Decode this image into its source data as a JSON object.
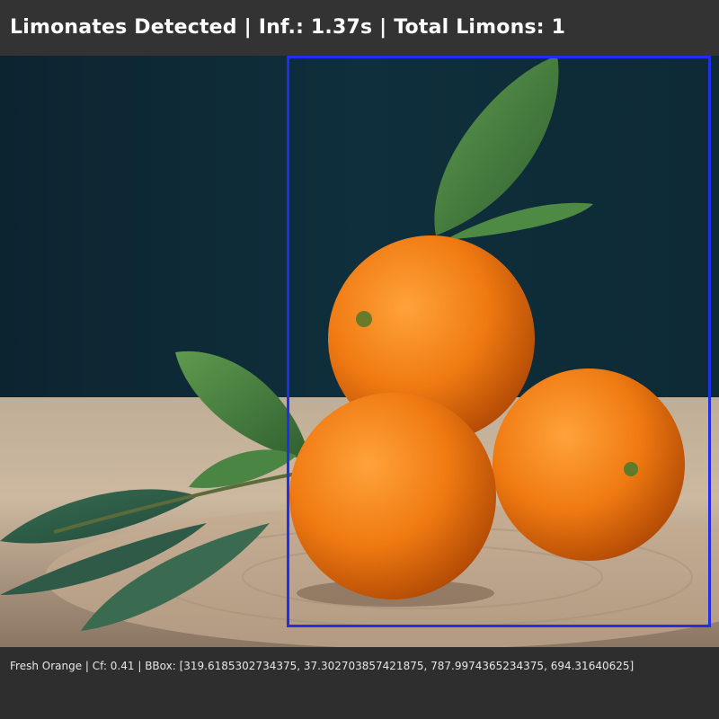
{
  "header": {
    "title": "Limonates Detected | Inf.: 1.37s | Total Limons: 1"
  },
  "detection": {
    "info_line": "Fresh Orange | Cf: 0.41 | BBox: [319.6185302734375, 37.302703857421875, 787.9974365234375, 694.31640625]",
    "box_color": "#1f2ef0"
  },
  "colors": {
    "background_top": "#0f2a36",
    "table": "#cdb8a0",
    "orange": "#f07a12",
    "leaf": "#3f7a3a",
    "bar": "#333333"
  }
}
